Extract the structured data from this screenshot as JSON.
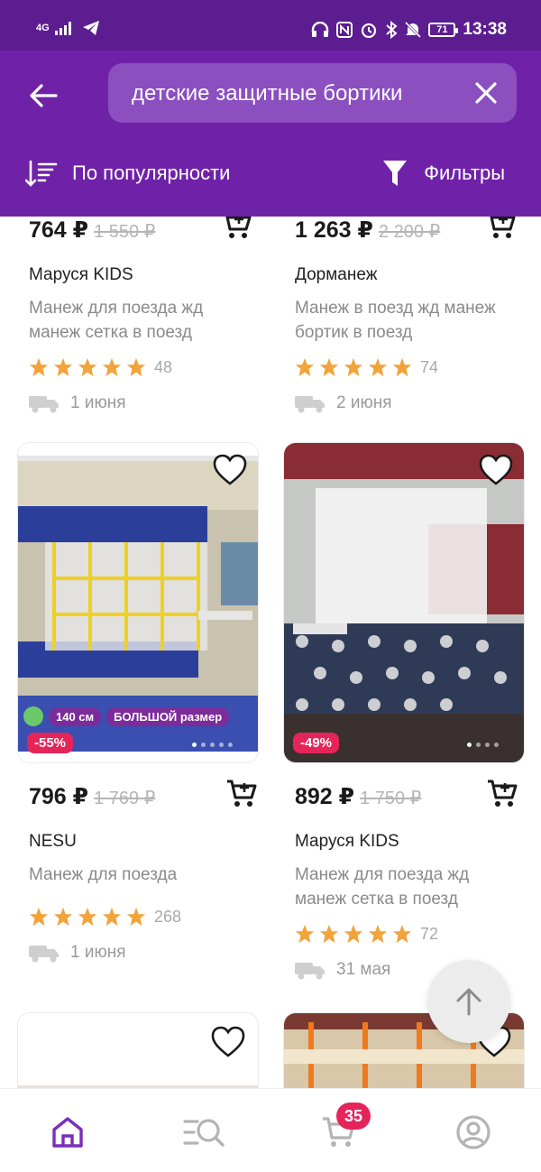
{
  "status_bar": {
    "network": "4G",
    "battery": "71",
    "time": "13:38",
    "icons": [
      "signal-icon",
      "telegram-icon",
      "headphones-icon",
      "nfc-icon",
      "alarm-icon",
      "bluetooth-icon",
      "mute-icon"
    ]
  },
  "header": {
    "search_value": "детские защитные бортики",
    "sort_label": "По популярности",
    "filter_label": "Фильтры",
    "color": "#6f22a8"
  },
  "products": [
    {
      "price": "764 ₽",
      "old_price": "1 550 ₽",
      "brand": "Маруся KIDS",
      "description": "Манеж для поезда жд манеж сетка в поезд",
      "rating": 5,
      "reviews": "48",
      "delivery": "1 июня"
    },
    {
      "price": "1 263 ₽",
      "old_price": "2 200 ₽",
      "brand": "Дорманеж",
      "description": "Манеж в поезд жд манеж бортик в поезд",
      "rating": 5,
      "reviews": "74",
      "delivery": "2 июня"
    },
    {
      "price": "796 ₽",
      "old_price": "1 769 ₽",
      "brand": "NESU",
      "description": "Манеж для поезда",
      "rating": 5,
      "reviews": "268",
      "delivery": "1 июня",
      "discount": "-55%",
      "badge_size": "140 см",
      "badge_large": "БОЛЬШОЙ размер"
    },
    {
      "price": "892 ₽",
      "old_price": "1 750 ₽",
      "brand": "Маруся KIDS",
      "description": "Манеж для поезда жд манеж сетка в поезд",
      "rating": 5,
      "reviews": "72",
      "delivery": "31 мая",
      "discount": "-49%"
    }
  ],
  "bottom_nav": {
    "cart_count": "35",
    "items": [
      "home-icon",
      "catalog-search-icon",
      "cart-icon",
      "profile-icon"
    ],
    "active": "home-icon"
  },
  "colors": {
    "accent": "#6f22a8",
    "discount": "#e5245a",
    "star": "#f2a33a"
  }
}
